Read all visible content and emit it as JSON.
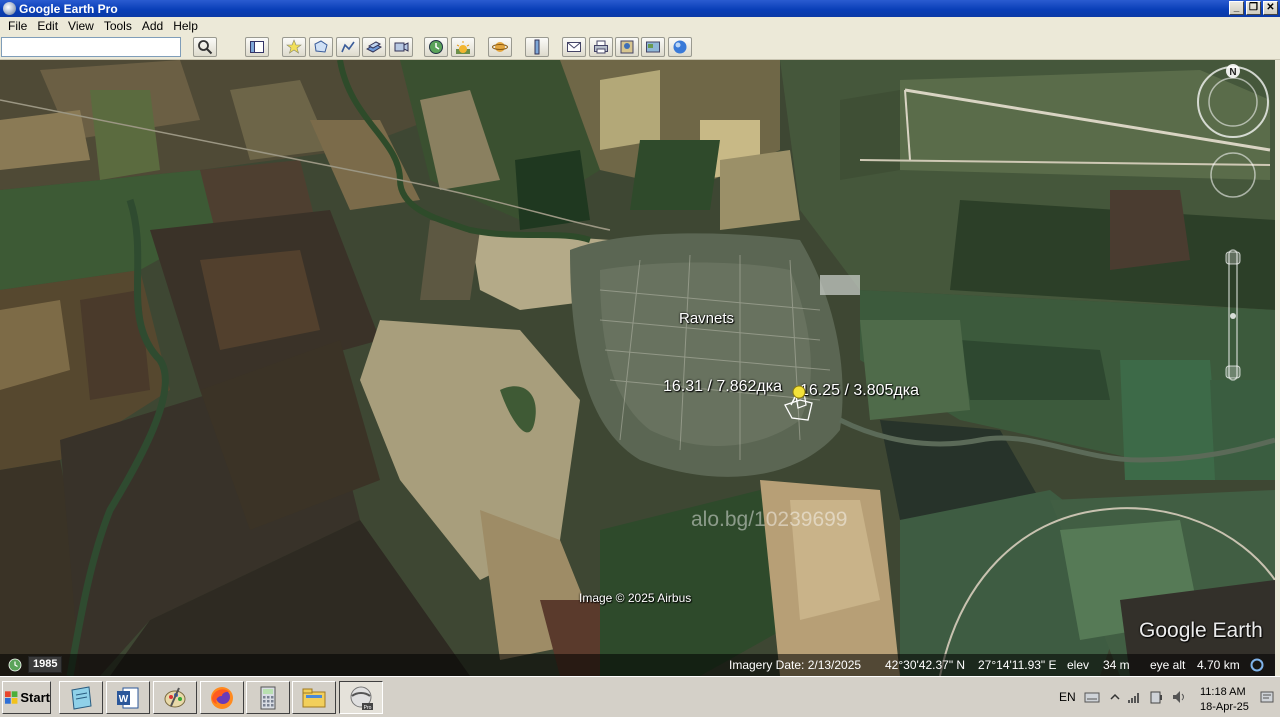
{
  "window": {
    "title": "Google Earth Pro",
    "minimize": "_",
    "restore": "❐",
    "close": "✕"
  },
  "menu": [
    "File",
    "Edit",
    "View",
    "Tools",
    "Add",
    "Help"
  ],
  "search": {
    "value": "",
    "placeholder": ""
  },
  "toolbar_icons": [
    "search-icon",
    "sidebar-icon",
    "placemark-icon",
    "polygon-icon",
    "path-icon",
    "overlay-icon",
    "tour-icon",
    "historical-imagery-icon",
    "sunlight-icon",
    "planets-icon",
    "ruler-icon",
    "email-icon",
    "print-icon",
    "save-image-icon",
    "map-image-icon",
    "google-maps-icon"
  ],
  "map": {
    "place_label": "Ravnets",
    "parcel_label_1": "16.31 / 7.862дка",
    "parcel_label_2": "16.25 / 3.805дка",
    "watermark": "alo.bg/10239699",
    "image_credit": "Image © 2025 Airbus",
    "brand": "Google Earth",
    "compass_north": "N"
  },
  "status": {
    "year": "1985",
    "imagery_date": "Imagery Date: 2/13/2025",
    "latitude": "42°30'42.37\" N",
    "longitude": "27°14'11.93\" E",
    "elev_label": "elev",
    "elev_value": "34 m",
    "eye_alt_label": "eye alt",
    "eye_alt_value": "4.70 km"
  },
  "taskbar": {
    "start_label": "Start",
    "apps": [
      "notepad-icon",
      "word-icon",
      "paint-icon",
      "firefox-icon",
      "calculator-icon",
      "explorer-icon",
      "google-earth-pro-icon"
    ],
    "language": "EN",
    "time": "11:18 AM",
    "date": "18-Apr-25"
  }
}
